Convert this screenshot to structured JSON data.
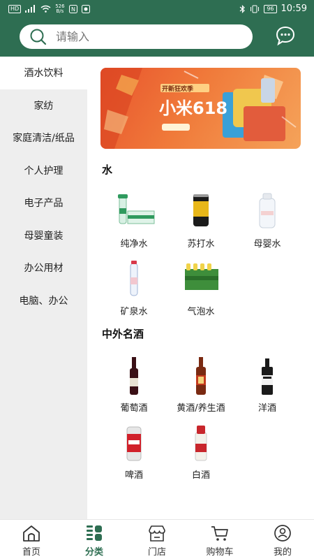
{
  "status_bar": {
    "left_chip": "HD",
    "net_speed_top": "526",
    "net_speed_bottom": "B/s",
    "battery": "96",
    "time": "10:59"
  },
  "search": {
    "placeholder": "请输入",
    "icon": "search-icon",
    "message_icon": "message-icon"
  },
  "sidebar": {
    "items": [
      {
        "label": "酒水饮料",
        "active": true
      },
      {
        "label": "家纺"
      },
      {
        "label": "家庭清洁/纸品"
      },
      {
        "label": "个人护理"
      },
      {
        "label": "电子产品"
      },
      {
        "label": "母婴童装"
      },
      {
        "label": "办公用材"
      },
      {
        "label": "电脑、办公"
      }
    ]
  },
  "banner": {
    "headline": "小米618",
    "tag": "开新狂欢季"
  },
  "sections": [
    {
      "title": "水",
      "items": [
        {
          "label": "纯净水"
        },
        {
          "label": "苏打水"
        },
        {
          "label": "母婴水"
        },
        {
          "label": "矿泉水"
        },
        {
          "label": "气泡水"
        }
      ]
    },
    {
      "title": "中外名酒",
      "items": [
        {
          "label": "葡萄酒"
        },
        {
          "label": "黄酒/养生酒"
        },
        {
          "label": "洋酒"
        },
        {
          "label": "啤酒"
        },
        {
          "label": "白酒"
        }
      ]
    }
  ],
  "tabbar": {
    "tabs": [
      {
        "label": "首页",
        "icon": "home-icon"
      },
      {
        "label": "分类",
        "icon": "category-icon",
        "active": true
      },
      {
        "label": "门店",
        "icon": "store-icon"
      },
      {
        "label": "购物车",
        "icon": "cart-icon"
      },
      {
        "label": "我的",
        "icon": "profile-icon"
      }
    ]
  },
  "colors": {
    "brand": "#2e6e52",
    "sidebar_bg": "#eeeeee"
  }
}
